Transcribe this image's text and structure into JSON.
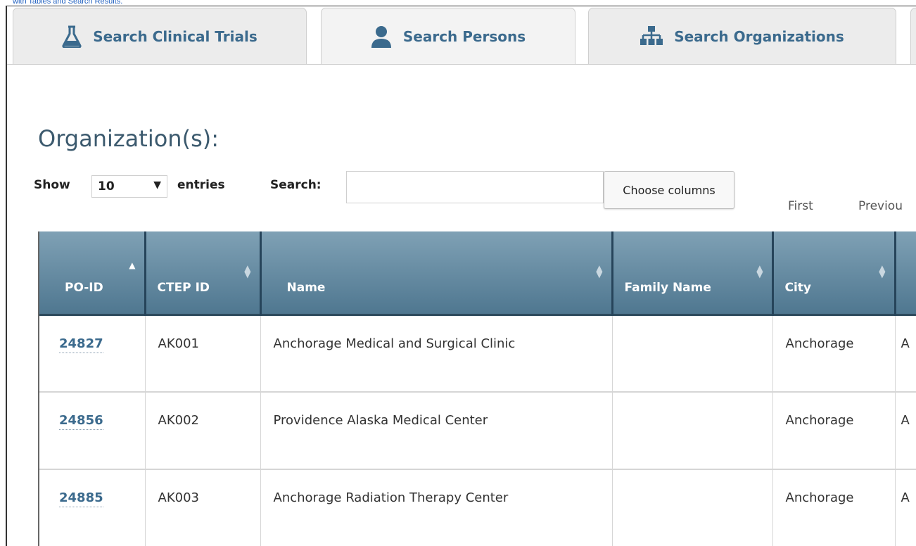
{
  "caption": "with Tables and Search Results.",
  "tabs": [
    {
      "label": "Search Clinical Trials",
      "icon": "flask-icon"
    },
    {
      "label": "Search Persons",
      "icon": "person-icon"
    },
    {
      "label": "Search Organizations",
      "icon": "org-chart-icon"
    }
  ],
  "page_title": "Organization(s):",
  "controls": {
    "show_label": "Show",
    "entries_value": "10",
    "entries_label": "entries",
    "search_label": "Search:",
    "search_value": "",
    "choose_columns_label": "Choose columns",
    "pager_first": "First",
    "pager_previous": "Previou"
  },
  "table": {
    "headers": [
      {
        "label": "PO-ID",
        "sort": "ascending"
      },
      {
        "label": "CTEP ID",
        "sort": "none"
      },
      {
        "label": "Name",
        "sort": "none"
      },
      {
        "label": "Family Name",
        "sort": "none"
      },
      {
        "label": "City",
        "sort": "none"
      }
    ],
    "rows": [
      {
        "po_id": "24827",
        "ctep_id": "AK001",
        "name": "Anchorage Medical and Surgical Clinic",
        "family_name": "",
        "city": "Anchorage",
        "next": "A"
      },
      {
        "po_id": "24856",
        "ctep_id": "AK002",
        "name": "Providence Alaska Medical Center",
        "family_name": "",
        "city": "Anchorage",
        "next": "A"
      },
      {
        "po_id": "24885",
        "ctep_id": "AK003",
        "name": "Anchorage Radiation Therapy Center",
        "family_name": "",
        "city": "Anchorage",
        "next": "A"
      }
    ]
  },
  "colors": {
    "tab_text": "#3b6a8d",
    "header_bg": "#5e8399",
    "link": "#3b6a8d"
  }
}
